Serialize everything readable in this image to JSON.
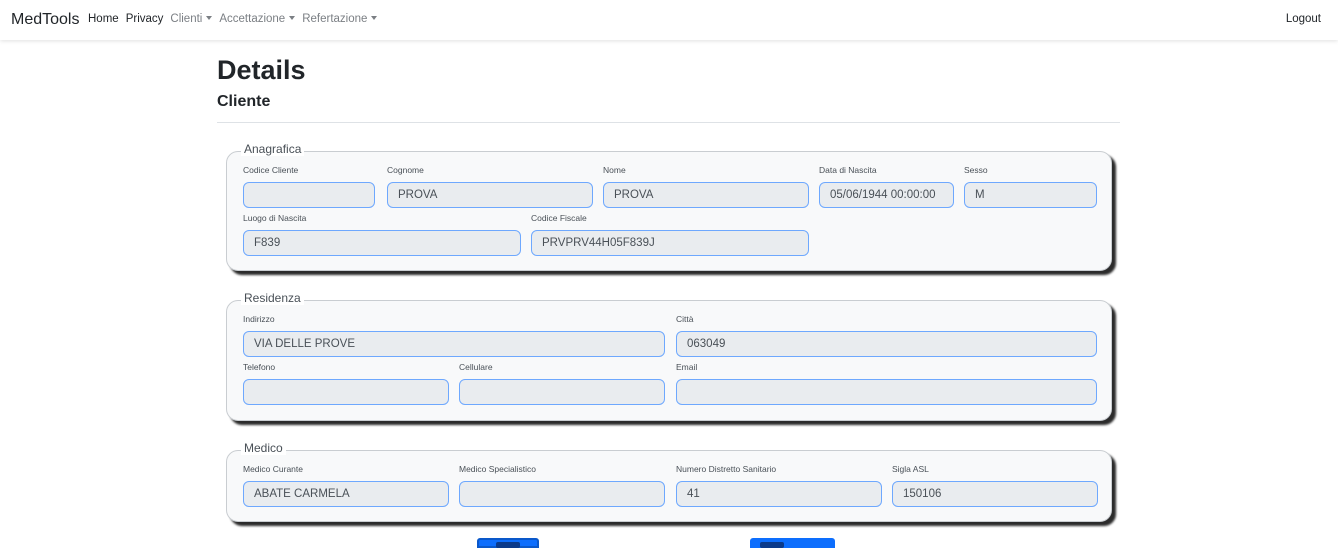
{
  "navbar": {
    "brand": "MedTools",
    "links": {
      "home": "Home",
      "privacy": "Privacy",
      "clienti": "Clienti",
      "accettazione": "Accettazione",
      "refertazione": "Refertazione"
    },
    "logout": "Logout"
  },
  "page": {
    "title": "Details",
    "subtitle": "Cliente"
  },
  "anagrafica": {
    "legend": "Anagrafica",
    "codice_cliente": {
      "label": "Codice Cliente",
      "value": ""
    },
    "cognome": {
      "label": "Cognome",
      "value": "PROVA"
    },
    "nome": {
      "label": "Nome",
      "value": "PROVA"
    },
    "data_nascita": {
      "label": "Data di Nascita",
      "value": "05/06/1944 00:00:00"
    },
    "sesso": {
      "label": "Sesso",
      "value": "M"
    },
    "luogo_nascita": {
      "label": "Luogo di Nascita",
      "value": "F839"
    },
    "codice_fiscale": {
      "label": "Codice Fiscale",
      "value": "PRVPRV44H05F839J"
    }
  },
  "residenza": {
    "legend": "Residenza",
    "indirizzo": {
      "label": "Indirizzo",
      "value": "VIA DELLE PROVE"
    },
    "citta": {
      "label": "Città",
      "value": "063049"
    },
    "telefono": {
      "label": "Telefono",
      "value": ""
    },
    "cellulare": {
      "label": "Cellulare",
      "value": ""
    },
    "email": {
      "label": "Email",
      "value": ""
    }
  },
  "medico": {
    "legend": "Medico",
    "medico_curante": {
      "label": "Medico Curante",
      "value": "ABATE CARMELA"
    },
    "medico_specialistico": {
      "label": "Medico Specialistico",
      "value": ""
    },
    "numero_distretto": {
      "label": "Numero Distretto Sanitario",
      "value": "41"
    },
    "sigla_asl": {
      "label": "Sigla ASL",
      "value": "150106"
    }
  },
  "colors": {
    "primary": "#0d6efd",
    "input_border": "#6ea8fe",
    "input_bg": "#e9ecef",
    "muted_nav": "#7b7f84"
  }
}
